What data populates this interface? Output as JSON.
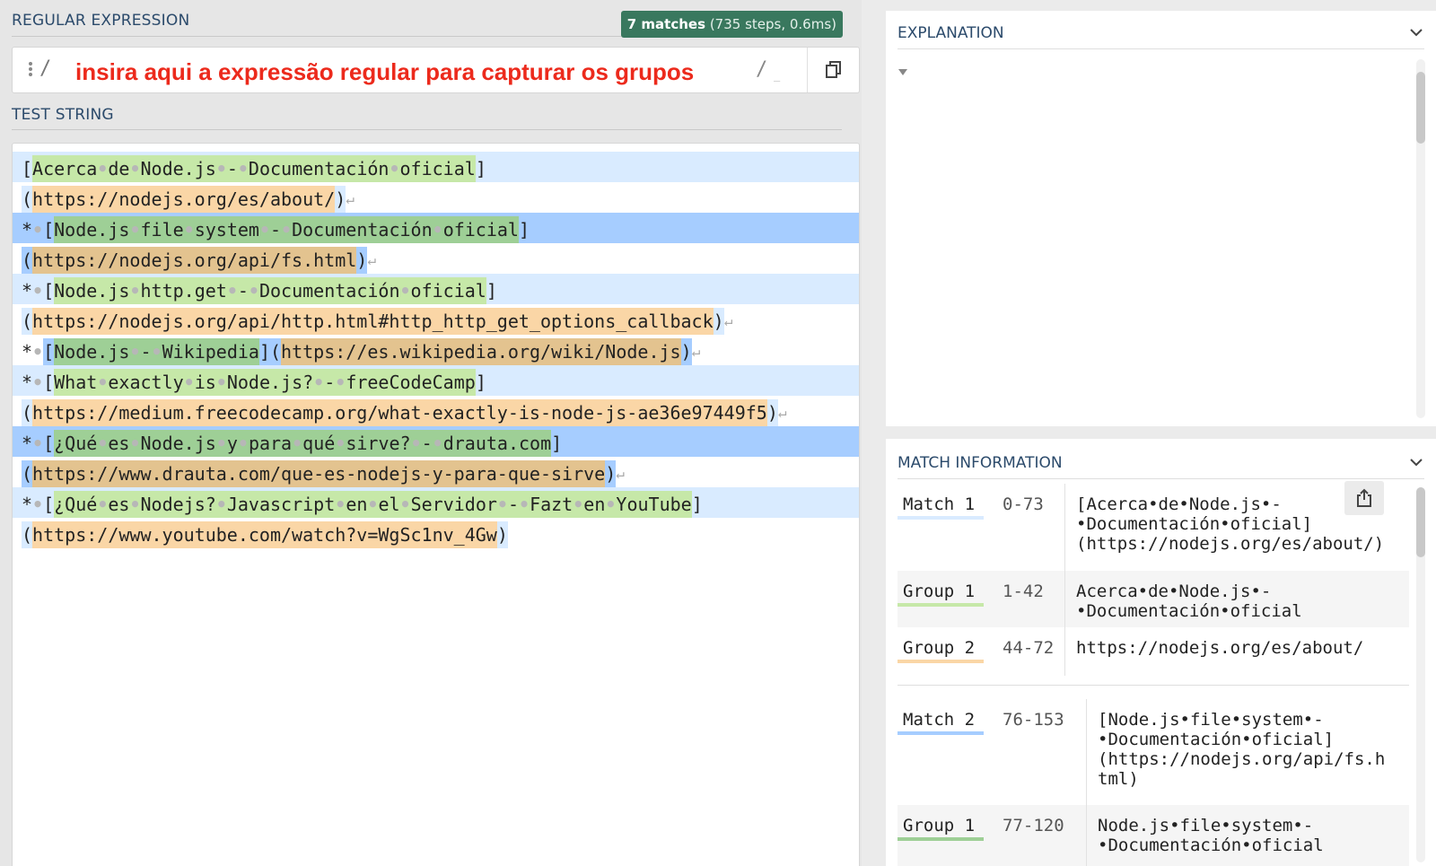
{
  "regex_section": {
    "title": "REGULAR EXPRESSION",
    "badge_count": "7 matches",
    "badge_detail": "(735 steps, 0.6ms)",
    "delimiter_open": "/",
    "placeholder": "insira aqui a expressão regular para capturar os grupos",
    "delimiter_close": "/",
    "flags": "_"
  },
  "test_section": {
    "title": "TEST STRING",
    "lines": [
      "[Acerca de Node.js - Documentación oficial]",
      "(https://nodejs.org/es/about/)",
      "* [Node.js file system - Documentación oficial]",
      "(https://nodejs.org/api/fs.html)",
      "* [Node.js http.get - Documentación oficial]",
      "(https://nodejs.org/api/http.html#http_http_get_options_callback)",
      "* [Node.js - Wikipedia](https://es.wikipedia.org/wiki/Node.js)",
      "* [What exactly is Node.js? - freeCodeCamp]",
      "(https://medium.freecodecamp.org/what-exactly-is-node-js-ae36e97449f5)",
      "* [¿Qué es Node.js y para qué sirve? - drauta.com]",
      "(https://www.drauta.com/que-es-nodejs-y-para-que-sirve)",
      "* [¿Qué es Nodejs? Javascript en el Servidor - Fazt en YouTube]",
      "(https://www.youtube.com/watch?v=WgSc1nv_4Gw)"
    ]
  },
  "explanation": {
    "title": "EXPLANATION"
  },
  "match_info": {
    "title": "MATCH INFORMATION",
    "rows": [
      {
        "label": "Match 1",
        "range": "0-73",
        "value": "[Acerca•de•Node.js•-\n•Documentación•oficial]\n(https://nodejs.org/es/about/)"
      },
      {
        "label": "Group 1",
        "range": "1-42",
        "value": "Acerca•de•Node.js•-\n•Documentación•oficial"
      },
      {
        "label": "Group 2",
        "range": "44-72",
        "value": "https://nodejs.org/es/about/"
      },
      {
        "label": "Match 2",
        "range": "76-153",
        "value": "[Node.js•file•system•-\n•Documentación•oficial]\n(https://nodejs.org/api/fs.h\ntml)"
      },
      {
        "label": "Group 1",
        "range": "77-120",
        "value": "Node.js•file•system•-\n•Documentación•oficial"
      }
    ]
  },
  "colors": {
    "match_light": "#d9ebff",
    "match_dark": "#a6cdff",
    "group1": "#c6e8a8",
    "group2": "#fad6a6",
    "badge": "#39785e",
    "placeholder": "#ec2a1c"
  }
}
